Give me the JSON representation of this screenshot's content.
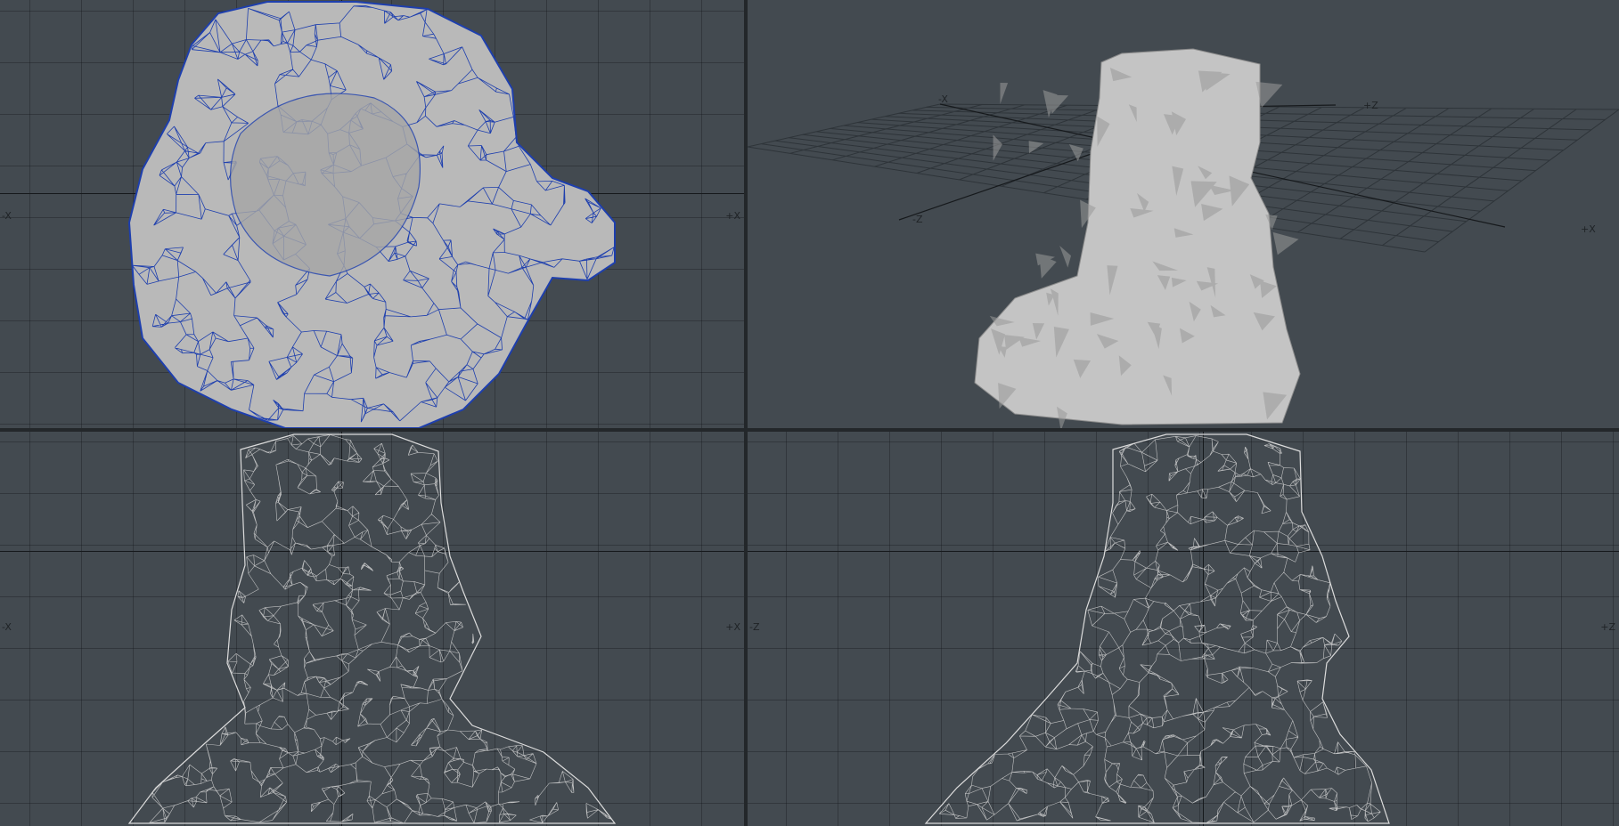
{
  "viewports": {
    "top": {
      "axis_left": "-X",
      "axis_right": "+X"
    },
    "perspective": {
      "axis_x_neg": "-X",
      "axis_z_neg": "-Z",
      "axis_z_pos": "+Z",
      "axis_x_pos": "+X"
    },
    "front": {
      "axis_left": "-X",
      "axis_right": "+X"
    },
    "right": {
      "axis_left": "-Z",
      "axis_right": "+Z"
    }
  },
  "colors": {
    "viewport_bg": "#434a50",
    "grid_line": "#353b40",
    "axis_line": "#16191c",
    "mesh_fill": "#b9b9b9",
    "selection_wire": "#1e3fae",
    "wireframe": "#d6d6d6"
  }
}
